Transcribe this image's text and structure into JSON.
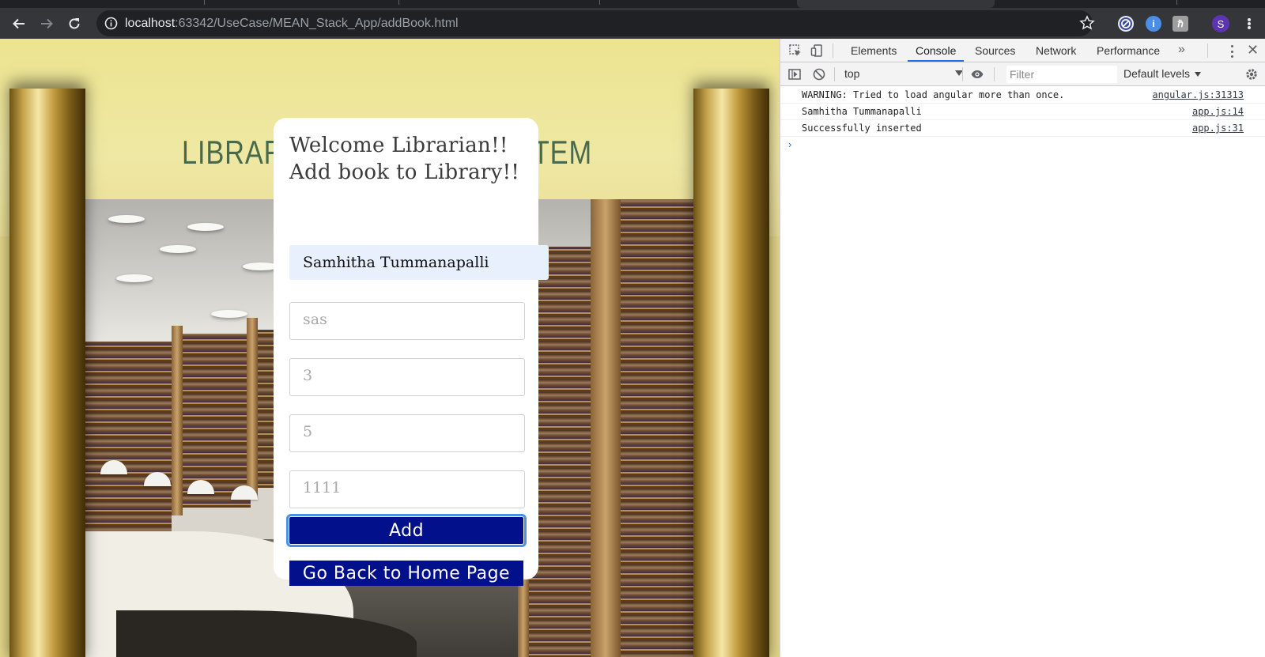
{
  "browser": {
    "url_host": "localhost",
    "url_path": ":63342/UseCase/MEAN_Stack_App/addBook.html",
    "profile_initial": "S"
  },
  "page": {
    "background_heading_left": "LIBRAR",
    "background_heading_right": "STEM",
    "card": {
      "title_line1": "Welcome Librarian!!",
      "title_line2": "Add book to Library!!",
      "fields": [
        {
          "value": "Samhitha Tummanapalli",
          "placeholder": ""
        },
        {
          "value": "",
          "placeholder": "sas"
        },
        {
          "value": "",
          "placeholder": "3"
        },
        {
          "value": "",
          "placeholder": "5"
        },
        {
          "value": "",
          "placeholder": "1111"
        }
      ],
      "add_button": "Add",
      "home_button": "Go Back to Home Page"
    },
    "colors": {
      "button": "#03108c",
      "background": "#ece48f"
    }
  },
  "devtools": {
    "tabs": [
      "Elements",
      "Console",
      "Sources",
      "Network",
      "Performance"
    ],
    "active_tab": "Console",
    "context": "top",
    "filter_placeholder": "Filter",
    "levels": "Default levels",
    "logs": [
      {
        "message": "WARNING: Tried to load angular more than once.",
        "source": "angular.js:31313"
      },
      {
        "message": "Samhitha Tummanapalli",
        "source": "app.js:14"
      },
      {
        "message": "Successfully inserted",
        "source": "app.js:31"
      }
    ],
    "prompt": "›"
  }
}
